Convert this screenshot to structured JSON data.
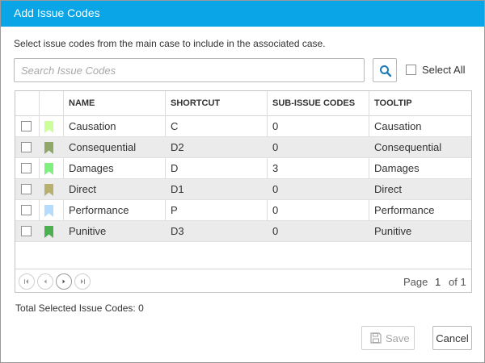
{
  "dialog": {
    "title": "Add Issue Codes",
    "instructions": "Select issue codes from the main case to include in the associated case."
  },
  "search": {
    "placeholder": "Search Issue Codes",
    "value": "",
    "button_icon": "search-icon"
  },
  "select_all": {
    "label": "Select All",
    "checked": false
  },
  "grid": {
    "columns": [
      "NAME",
      "SHORTCUT",
      "SUB-ISSUE CODES",
      "TOOLTIP"
    ],
    "rows": [
      {
        "name": "Causation",
        "shortcut": "C",
        "sub_issue_codes": "0",
        "tooltip": "Causation",
        "flag_color": "#ccff99",
        "checked": false
      },
      {
        "name": "Consequential",
        "shortcut": "D2",
        "sub_issue_codes": "0",
        "tooltip": "Consequential",
        "flag_color": "#8fa86a",
        "checked": false
      },
      {
        "name": "Damages",
        "shortcut": "D",
        "sub_issue_codes": "3",
        "tooltip": "Damages",
        "flag_color": "#7ff07f",
        "checked": false
      },
      {
        "name": "Direct",
        "shortcut": "D1",
        "sub_issue_codes": "0",
        "tooltip": "Direct",
        "flag_color": "#b8b06e",
        "checked": false
      },
      {
        "name": "Performance",
        "shortcut": "P",
        "sub_issue_codes": "0",
        "tooltip": "Performance",
        "flag_color": "#b3dcff",
        "checked": false
      },
      {
        "name": "Punitive",
        "shortcut": "D3",
        "sub_issue_codes": "0",
        "tooltip": "Punitive",
        "flag_color": "#4caf50",
        "checked": false
      }
    ]
  },
  "pager": {
    "page_label": "Page",
    "page": "1",
    "of_label": "of 1",
    "buttons": [
      "first-page-icon",
      "prev-page-icon",
      "next-page-icon",
      "last-page-icon"
    ]
  },
  "footer": {
    "total_label": "Total Selected Issue Codes:",
    "total_value": "0",
    "save_label": "Save",
    "save_icon": "save-icon",
    "cancel_label": "Cancel"
  },
  "colors": {
    "titlebar": "#0aa5e6",
    "search_icon": "#1a7ab8"
  }
}
